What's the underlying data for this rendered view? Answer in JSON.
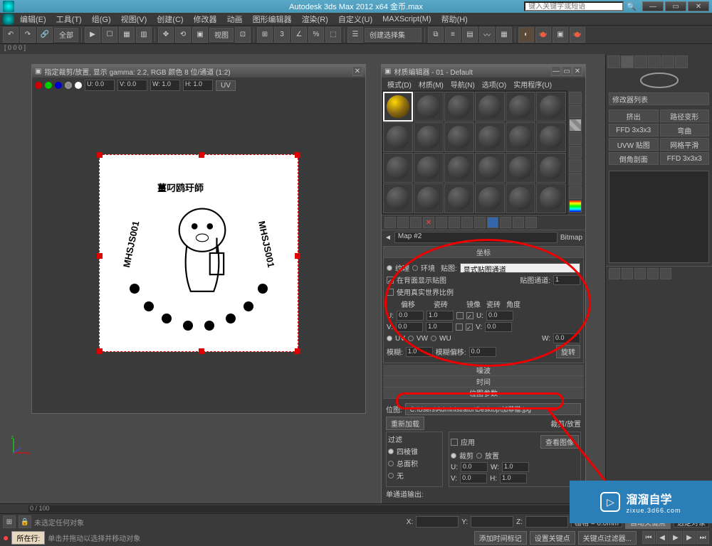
{
  "title": "Autodesk 3ds Max  2012 x64   金币.max",
  "search_placeholder": "键入关键字或短语",
  "menu": [
    "编辑(E)",
    "工具(T)",
    "组(G)",
    "视图(V)",
    "创建(C)",
    "修改器",
    "动画",
    "图形编辑器",
    "渲染(R)",
    "自定义(U)",
    "MAXScript(M)",
    "帮助(H)"
  ],
  "toolbar": {
    "selection_set": "全部",
    "view_label": "视图",
    "create_set": "创建选择集"
  },
  "viewport": {
    "title": "指定裁剪/放置, 显示 gamma: 2.2, RGB 颜色 8 位/通道 (1:2)",
    "u": "U: 0.0",
    "v": "V: 0.0",
    "w": "W: 1.0",
    "h": "H: 1.0",
    "uv_btn": "UV",
    "stamp_top": "薑叼鸥玗師",
    "stamp_left": "MHSJS001",
    "stamp_right": "MHSJS001"
  },
  "material_editor": {
    "title": "材质编辑器 - 01 - Default",
    "menu": [
      "模式(D)",
      "材质(M)",
      "导航(N)",
      "选项(O)",
      "实用程序(U)"
    ],
    "nav_map": "Map #2",
    "nav_type": "Bitmap",
    "coords": {
      "header": "坐标",
      "texture": "纹理",
      "environ": "环境",
      "mapping": "贴图:",
      "mapping_value": "显式贴图通道",
      "show_back": "在背面显示贴图",
      "map_channel": "贴图通道:",
      "map_channel_val": "1",
      "real_world": "使用真实世界比例",
      "offset": "偏移",
      "tiling": "瓷砖",
      "mirror": "镜像",
      "tile": "瓷砖",
      "angle": "角度",
      "u_label": "U:",
      "v_label": "V:",
      "w_label": "W:",
      "u_off": "0.0",
      "u_tile": "1.0",
      "u_ang": "0.0",
      "v_off": "0.0",
      "v_tile": "1.0",
      "v_ang": "0.0",
      "w_ang": "0.0",
      "uv": "UV",
      "vw": "VW",
      "wu": "WU",
      "blur": "模糊:",
      "blur_val": "1.0",
      "blur_off": "模糊偏移:",
      "blur_off_val": "0.0",
      "rotate": "旋转"
    },
    "noise_header": "噪波",
    "time_header": "时间",
    "bitmap_params": "位图参数",
    "bitmap_label": "位图:",
    "bitmap_path": "C:\\Users\\Administrator\\Desktop\\加菲猫.jpg",
    "reload": "重新加载",
    "crop_place": "裁剪/放置",
    "filter": "过滤",
    "pyramidal": "四棱锥",
    "summed": "总面积",
    "none": "无",
    "apply": "应用",
    "view_image": "查看图像",
    "crop": "裁剪",
    "place": "放置",
    "u2": "U:",
    "u2v": "0.0",
    "w2": "W:",
    "w2v": "1.0",
    "v2": "V:",
    "v2v": "0.0",
    "h2": "H:",
    "h2v": "1.0",
    "mono_out": "单通道输出:"
  },
  "right_panel": {
    "modifier_list": "修改器列表",
    "buttons": [
      [
        "挤出",
        "路径变形"
      ],
      [
        "FFD 3x3x3",
        "弯曲"
      ],
      [
        "UVW 贴图",
        "网格平滑"
      ],
      [
        "倒角剖面",
        "FFD 3x3x3"
      ]
    ]
  },
  "coord_readout": "[ 0 0 0 ]",
  "timeline": {
    "range": "0 / 100"
  },
  "status": {
    "no_selection": "未选定任何对象",
    "hint": "单击并拖动以选择并移动对象",
    "x": "X:",
    "y": "Y:",
    "z": "Z:",
    "grid": "栅格 = 0.0mm",
    "autokey": "自动关键点",
    "selected": "选定对象",
    "add_time": "添加时间标记",
    "set_key": "设置关键点",
    "key_filter": "关键点过滤器...",
    "row_label": "所在行:"
  },
  "watermark": {
    "name": "溜溜自学",
    "url": "zixue.3d66.com"
  }
}
